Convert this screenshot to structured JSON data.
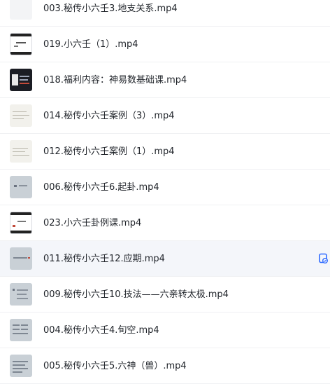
{
  "files": [
    {
      "name": "003.秘传小六壬3.地支关系.mp4",
      "thumb": "light"
    },
    {
      "name": "019.小六壬（1）.mp4",
      "thumb": "dark-frame"
    },
    {
      "name": "018.福利内容：神易数基础课.mp4",
      "thumb": "dark"
    },
    {
      "name": "014.秘传小六壬案例（3）.mp4",
      "thumb": "paper"
    },
    {
      "name": "012.秘传小六壬案例（1）.mp4",
      "thumb": "paper"
    },
    {
      "name": "006.秘传小六壬6.起卦.mp4",
      "thumb": "gray"
    },
    {
      "name": "023.小六壬卦例课.mp4",
      "thumb": "dark-frame"
    },
    {
      "name": "011.秘传小六壬12.应期.mp4",
      "thumb": "gray",
      "selected": true,
      "action_icon": "save-to-cloud-icon"
    },
    {
      "name": "009.秘传小六壬10.技法——六亲转太极.mp4",
      "thumb": "gray"
    },
    {
      "name": "004.秘传小六壬4.旬空.mp4",
      "thumb": "gray"
    },
    {
      "name": "005.秘传小六壬5.六神（兽）.mp4",
      "thumb": "gray"
    }
  ],
  "colors": {
    "accent": "#2f6bff",
    "row_hover": "#f4f6fa",
    "divider": "#f0f1f3"
  }
}
